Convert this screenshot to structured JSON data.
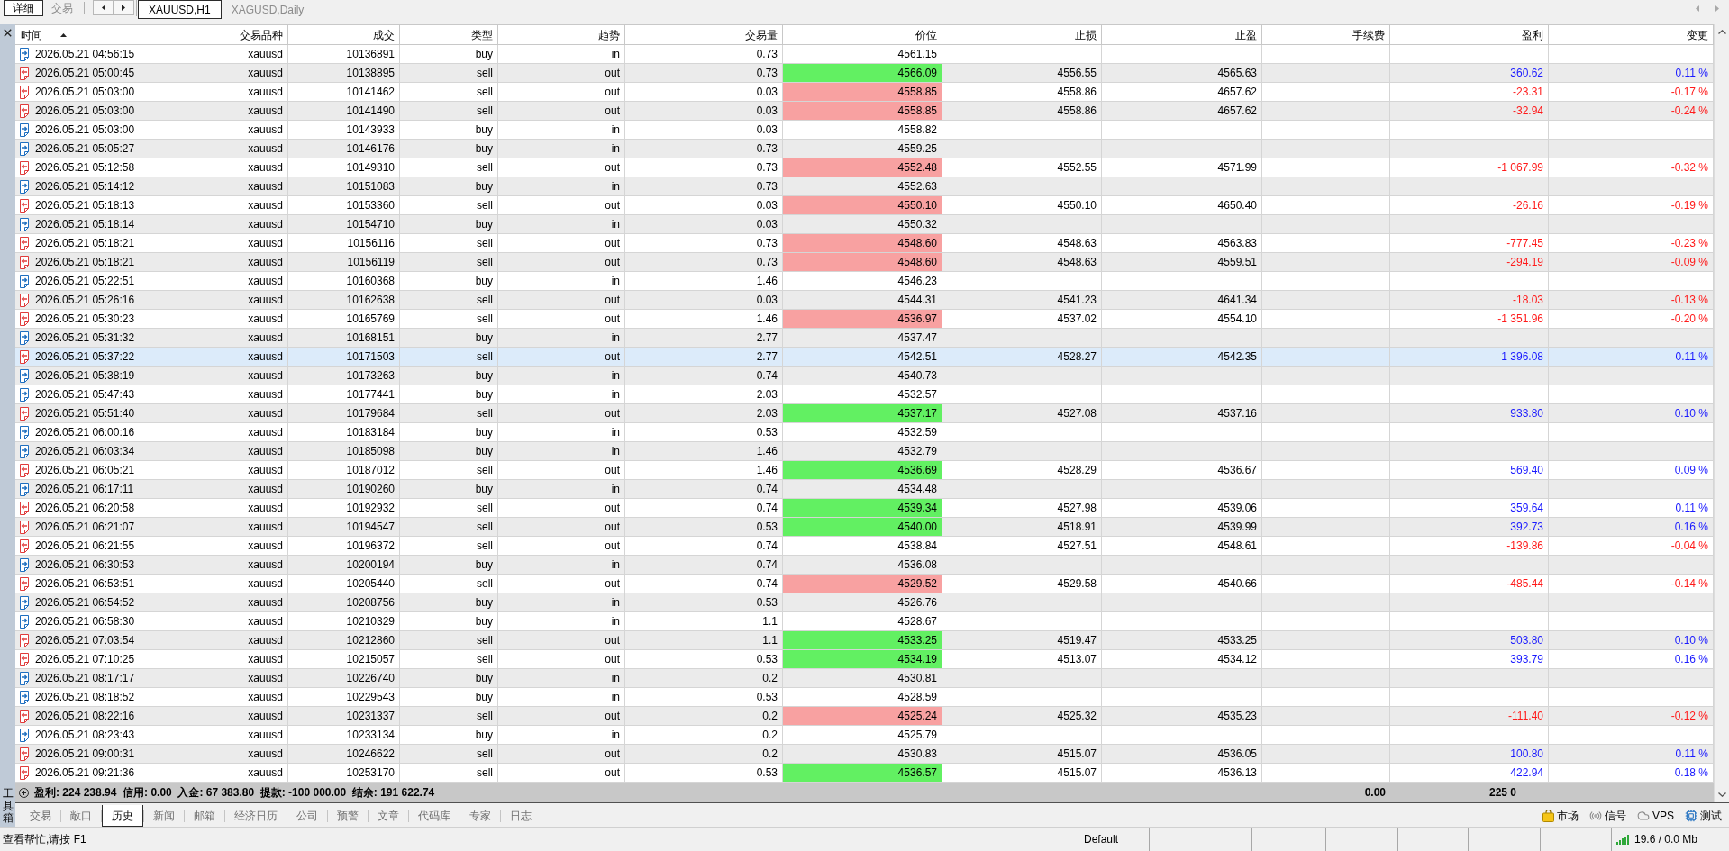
{
  "view_tabs": [
    {
      "label": "详细",
      "selected": true
    },
    {
      "label": "交易",
      "selected": false
    }
  ],
  "chart_tabs": [
    {
      "label": "XAUUSD,H1",
      "selected": true
    },
    {
      "label": "XAGUSD,Daily",
      "selected": false
    }
  ],
  "toolbox": {
    "title": "工具箱"
  },
  "table": {
    "columns": [
      {
        "label": "时间",
        "sorted": true
      },
      {
        "label": "交易品种",
        "sorted": false
      },
      {
        "label": "成交",
        "sorted": false
      },
      {
        "label": "类型",
        "sorted": false
      },
      {
        "label": "趋势",
        "sorted": false
      },
      {
        "label": "交易量",
        "sorted": false
      },
      {
        "label": "价位",
        "sorted": false
      },
      {
        "label": "止损",
        "sorted": false
      },
      {
        "label": "止盈",
        "sorted": false
      },
      {
        "label": "手续费",
        "sorted": false
      },
      {
        "label": "盈利",
        "sorted": false
      },
      {
        "label": "变更",
        "sorted": false
      }
    ],
    "rows": [
      {
        "kind": "buy",
        "selected": false,
        "time": "2026.05.21 04:56:15",
        "symbol": "xauusd",
        "deal": "10136891",
        "type": "buy",
        "direction": "in",
        "volume": "0.73",
        "price": {
          "value": "4561.15"
        }
      },
      {
        "kind": "sell",
        "selected": false,
        "time": "2026.05.21 05:00:45",
        "symbol": "xauusd",
        "deal": "10138895",
        "type": "sell",
        "direction": "out",
        "volume": "0.73",
        "price": {
          "value": "4566.09",
          "color": "#62f062"
        },
        "stop_loss": "4556.55",
        "take_profit": "4565.63",
        "profit": {
          "value": "360.62",
          "color": "#1a1aff"
        },
        "change": {
          "value": "0.11 %",
          "color": "#1a1aff"
        }
      },
      {
        "kind": "sell",
        "selected": false,
        "time": "2026.05.21 05:03:00",
        "symbol": "xauusd",
        "deal": "10141462",
        "type": "sell",
        "direction": "out",
        "volume": "0.03",
        "price": {
          "value": "4558.85",
          "color": "#f8a1a1"
        },
        "stop_loss": "4558.86",
        "take_profit": "4657.62",
        "profit": {
          "value": "-23.31",
          "color": "#ff1a1a"
        },
        "change": {
          "value": "-0.17 %",
          "color": "#ff1a1a"
        }
      },
      {
        "kind": "sell",
        "selected": false,
        "time": "2026.05.21 05:03:00",
        "symbol": "xauusd",
        "deal": "10141490",
        "type": "sell",
        "direction": "out",
        "volume": "0.03",
        "price": {
          "value": "4558.85",
          "color": "#f8a1a1"
        },
        "stop_loss": "4558.86",
        "take_profit": "4657.62",
        "profit": {
          "value": "-32.94",
          "color": "#ff1a1a"
        },
        "change": {
          "value": "-0.24 %",
          "color": "#ff1a1a"
        }
      },
      {
        "kind": "buy",
        "selected": false,
        "time": "2026.05.21 05:03:00",
        "symbol": "xauusd",
        "deal": "10143933",
        "type": "buy",
        "direction": "in",
        "volume": "0.03",
        "price": {
          "value": "4558.82"
        }
      },
      {
        "kind": "buy",
        "selected": false,
        "time": "2026.05.21 05:05:27",
        "symbol": "xauusd",
        "deal": "10146176",
        "type": "buy",
        "direction": "in",
        "volume": "0.73",
        "price": {
          "value": "4559.25"
        }
      },
      {
        "kind": "sell",
        "selected": false,
        "time": "2026.05.21 05:12:58",
        "symbol": "xauusd",
        "deal": "10149310",
        "type": "sell",
        "direction": "out",
        "volume": "0.73",
        "price": {
          "value": "4552.48",
          "color": "#f8a1a1"
        },
        "stop_loss": "4552.55",
        "take_profit": "4571.99",
        "profit": {
          "value": "-1 067.99",
          "color": "#ff1a1a"
        },
        "change": {
          "value": "-0.32 %",
          "color": "#ff1a1a"
        }
      },
      {
        "kind": "buy",
        "selected": false,
        "time": "2026.05.21 05:14:12",
        "symbol": "xauusd",
        "deal": "10151083",
        "type": "buy",
        "direction": "in",
        "volume": "0.73",
        "price": {
          "value": "4552.63"
        }
      },
      {
        "kind": "sell",
        "selected": false,
        "time": "2026.05.21 05:18:13",
        "symbol": "xauusd",
        "deal": "10153360",
        "type": "sell",
        "direction": "out",
        "volume": "0.03",
        "price": {
          "value": "4550.10",
          "color": "#f8a1a1"
        },
        "stop_loss": "4550.10",
        "take_profit": "4650.40",
        "profit": {
          "value": "-26.16",
          "color": "#ff1a1a"
        },
        "change": {
          "value": "-0.19 %",
          "color": "#ff1a1a"
        }
      },
      {
        "kind": "buy",
        "selected": false,
        "time": "2026.05.21 05:18:14",
        "symbol": "xauusd",
        "deal": "10154710",
        "type": "buy",
        "direction": "in",
        "volume": "0.03",
        "price": {
          "value": "4550.32"
        }
      },
      {
        "kind": "sell",
        "selected": false,
        "time": "2026.05.21 05:18:21",
        "symbol": "xauusd",
        "deal": "10156116",
        "type": "sell",
        "direction": "out",
        "volume": "0.73",
        "price": {
          "value": "4548.60",
          "color": "#f8a1a1"
        },
        "stop_loss": "4548.63",
        "take_profit": "4563.83",
        "profit": {
          "value": "-777.45",
          "color": "#ff1a1a"
        },
        "change": {
          "value": "-0.23 %",
          "color": "#ff1a1a"
        }
      },
      {
        "kind": "sell",
        "selected": false,
        "time": "2026.05.21 05:18:21",
        "symbol": "xauusd",
        "deal": "10156119",
        "type": "sell",
        "direction": "out",
        "volume": "0.73",
        "price": {
          "value": "4548.60",
          "color": "#f8a1a1"
        },
        "stop_loss": "4548.63",
        "take_profit": "4559.51",
        "profit": {
          "value": "-294.19",
          "color": "#ff1a1a"
        },
        "change": {
          "value": "-0.09 %",
          "color": "#ff1a1a"
        }
      },
      {
        "kind": "buy",
        "selected": false,
        "time": "2026.05.21 05:22:51",
        "symbol": "xauusd",
        "deal": "10160368",
        "type": "buy",
        "direction": "in",
        "volume": "1.46",
        "price": {
          "value": "4546.23"
        }
      },
      {
        "kind": "sell",
        "selected": false,
        "time": "2026.05.21 05:26:16",
        "symbol": "xauusd",
        "deal": "10162638",
        "type": "sell",
        "direction": "out",
        "volume": "0.03",
        "price": {
          "value": "4544.31"
        },
        "stop_loss": "4541.23",
        "take_profit": "4641.34",
        "profit": {
          "value": "-18.03",
          "color": "#ff1a1a"
        },
        "change": {
          "value": "-0.13 %",
          "color": "#ff1a1a"
        }
      },
      {
        "kind": "sell",
        "selected": false,
        "time": "2026.05.21 05:30:23",
        "symbol": "xauusd",
        "deal": "10165769",
        "type": "sell",
        "direction": "out",
        "volume": "1.46",
        "price": {
          "value": "4536.97",
          "color": "#f8a1a1"
        },
        "stop_loss": "4537.02",
        "take_profit": "4554.10",
        "profit": {
          "value": "-1 351.96",
          "color": "#ff1a1a"
        },
        "change": {
          "value": "-0.20 %",
          "color": "#ff1a1a"
        }
      },
      {
        "kind": "buy",
        "selected": false,
        "time": "2026.05.21 05:31:32",
        "symbol": "xauusd",
        "deal": "10168151",
        "type": "buy",
        "direction": "in",
        "volume": "2.77",
        "price": {
          "value": "4537.47"
        }
      },
      {
        "kind": "sell",
        "selected": true,
        "time": "2026.05.21 05:37:22",
        "symbol": "xauusd",
        "deal": "10171503",
        "type": "sell",
        "direction": "out",
        "volume": "2.77",
        "price": {
          "value": "4542.51"
        },
        "stop_loss": "4528.27",
        "take_profit": "4542.35",
        "profit": {
          "value": "1 396.08",
          "color": "#1a1aff"
        },
        "change": {
          "value": "0.11 %",
          "color": "#1a1aff"
        }
      },
      {
        "kind": "buy",
        "selected": false,
        "time": "2026.05.21 05:38:19",
        "symbol": "xauusd",
        "deal": "10173263",
        "type": "buy",
        "direction": "in",
        "volume": "0.74",
        "price": {
          "value": "4540.73"
        }
      },
      {
        "kind": "buy",
        "selected": false,
        "time": "2026.05.21 05:47:43",
        "symbol": "xauusd",
        "deal": "10177441",
        "type": "buy",
        "direction": "in",
        "volume": "2.03",
        "price": {
          "value": "4532.57"
        }
      },
      {
        "kind": "sell",
        "selected": false,
        "time": "2026.05.21 05:51:40",
        "symbol": "xauusd",
        "deal": "10179684",
        "type": "sell",
        "direction": "out",
        "volume": "2.03",
        "price": {
          "value": "4537.17",
          "color": "#62f062"
        },
        "stop_loss": "4527.08",
        "take_profit": "4537.16",
        "profit": {
          "value": "933.80",
          "color": "#1a1aff"
        },
        "change": {
          "value": "0.10 %",
          "color": "#1a1aff"
        }
      },
      {
        "kind": "buy",
        "selected": false,
        "time": "2026.05.21 06:00:16",
        "symbol": "xauusd",
        "deal": "10183184",
        "type": "buy",
        "direction": "in",
        "volume": "0.53",
        "price": {
          "value": "4532.59"
        }
      },
      {
        "kind": "buy",
        "selected": false,
        "time": "2026.05.21 06:03:34",
        "symbol": "xauusd",
        "deal": "10185098",
        "type": "buy",
        "direction": "in",
        "volume": "1.46",
        "price": {
          "value": "4532.79"
        }
      },
      {
        "kind": "sell",
        "selected": false,
        "time": "2026.05.21 06:05:21",
        "symbol": "xauusd",
        "deal": "10187012",
        "type": "sell",
        "direction": "out",
        "volume": "1.46",
        "price": {
          "value": "4536.69",
          "color": "#62f062"
        },
        "stop_loss": "4528.29",
        "take_profit": "4536.67",
        "profit": {
          "value": "569.40",
          "color": "#1a1aff"
        },
        "change": {
          "value": "0.09 %",
          "color": "#1a1aff"
        }
      },
      {
        "kind": "buy",
        "selected": false,
        "time": "2026.05.21 06:17:11",
        "symbol": "xauusd",
        "deal": "10190260",
        "type": "buy",
        "direction": "in",
        "volume": "0.74",
        "price": {
          "value": "4534.48"
        }
      },
      {
        "kind": "sell",
        "selected": false,
        "time": "2026.05.21 06:20:58",
        "symbol": "xauusd",
        "deal": "10192932",
        "type": "sell",
        "direction": "out",
        "volume": "0.74",
        "price": {
          "value": "4539.34",
          "color": "#62f062"
        },
        "stop_loss": "4527.98",
        "take_profit": "4539.06",
        "profit": {
          "value": "359.64",
          "color": "#1a1aff"
        },
        "change": {
          "value": "0.11 %",
          "color": "#1a1aff"
        }
      },
      {
        "kind": "sell",
        "selected": false,
        "time": "2026.05.21 06:21:07",
        "symbol": "xauusd",
        "deal": "10194547",
        "type": "sell",
        "direction": "out",
        "volume": "0.53",
        "price": {
          "value": "4540.00",
          "color": "#62f062"
        },
        "stop_loss": "4518.91",
        "take_profit": "4539.99",
        "profit": {
          "value": "392.73",
          "color": "#1a1aff"
        },
        "change": {
          "value": "0.16 %",
          "color": "#1a1aff"
        }
      },
      {
        "kind": "sell",
        "selected": false,
        "time": "2026.05.21 06:21:55",
        "symbol": "xauusd",
        "deal": "10196372",
        "type": "sell",
        "direction": "out",
        "volume": "0.74",
        "price": {
          "value": "4538.84"
        },
        "stop_loss": "4527.51",
        "take_profit": "4548.61",
        "profit": {
          "value": "-139.86",
          "color": "#ff1a1a"
        },
        "change": {
          "value": "-0.04 %",
          "color": "#ff1a1a"
        }
      },
      {
        "kind": "buy",
        "selected": false,
        "time": "2026.05.21 06:30:53",
        "symbol": "xauusd",
        "deal": "10200194",
        "type": "buy",
        "direction": "in",
        "volume": "0.74",
        "price": {
          "value": "4536.08"
        }
      },
      {
        "kind": "sell",
        "selected": false,
        "time": "2026.05.21 06:53:51",
        "symbol": "xauusd",
        "deal": "10205440",
        "type": "sell",
        "direction": "out",
        "volume": "0.74",
        "price": {
          "value": "4529.52",
          "color": "#f8a1a1"
        },
        "stop_loss": "4529.58",
        "take_profit": "4540.66",
        "profit": {
          "value": "-485.44",
          "color": "#ff1a1a"
        },
        "change": {
          "value": "-0.14 %",
          "color": "#ff1a1a"
        }
      },
      {
        "kind": "buy",
        "selected": false,
        "time": "2026.05.21 06:54:52",
        "symbol": "xauusd",
        "deal": "10208756",
        "type": "buy",
        "direction": "in",
        "volume": "0.53",
        "price": {
          "value": "4526.76"
        }
      },
      {
        "kind": "buy",
        "selected": false,
        "time": "2026.05.21 06:58:30",
        "symbol": "xauusd",
        "deal": "10210329",
        "type": "buy",
        "direction": "in",
        "volume": "1.1",
        "price": {
          "value": "4528.67"
        }
      },
      {
        "kind": "sell",
        "selected": false,
        "time": "2026.05.21 07:03:54",
        "symbol": "xauusd",
        "deal": "10212860",
        "type": "sell",
        "direction": "out",
        "volume": "1.1",
        "price": {
          "value": "4533.25",
          "color": "#62f062"
        },
        "stop_loss": "4519.47",
        "take_profit": "4533.25",
        "profit": {
          "value": "503.80",
          "color": "#1a1aff"
        },
        "change": {
          "value": "0.10 %",
          "color": "#1a1aff"
        }
      },
      {
        "kind": "sell",
        "selected": false,
        "time": "2026.05.21 07:10:25",
        "symbol": "xauusd",
        "deal": "10215057",
        "type": "sell",
        "direction": "out",
        "volume": "0.53",
        "price": {
          "value": "4534.19",
          "color": "#62f062"
        },
        "stop_loss": "4513.07",
        "take_profit": "4534.12",
        "profit": {
          "value": "393.79",
          "color": "#1a1aff"
        },
        "change": {
          "value": "0.16 %",
          "color": "#1a1aff"
        }
      },
      {
        "kind": "buy",
        "selected": false,
        "time": "2026.05.21 08:17:17",
        "symbol": "xauusd",
        "deal": "10226740",
        "type": "buy",
        "direction": "in",
        "volume": "0.2",
        "price": {
          "value": "4530.81"
        }
      },
      {
        "kind": "buy",
        "selected": false,
        "time": "2026.05.21 08:18:52",
        "symbol": "xauusd",
        "deal": "10229543",
        "type": "buy",
        "direction": "in",
        "volume": "0.53",
        "price": {
          "value": "4528.59"
        }
      },
      {
        "kind": "sell",
        "selected": false,
        "time": "2026.05.21 08:22:16",
        "symbol": "xauusd",
        "deal": "10231337",
        "type": "sell",
        "direction": "out",
        "volume": "0.2",
        "price": {
          "value": "4525.24",
          "color": "#f8a1a1"
        },
        "stop_loss": "4525.32",
        "take_profit": "4535.23",
        "profit": {
          "value": "-111.40",
          "color": "#ff1a1a"
        },
        "change": {
          "value": "-0.12 %",
          "color": "#ff1a1a"
        }
      },
      {
        "kind": "buy",
        "selected": false,
        "time": "2026.05.21 08:23:43",
        "symbol": "xauusd",
        "deal": "10233134",
        "type": "buy",
        "direction": "in",
        "volume": "0.2",
        "price": {
          "value": "4525.79"
        }
      },
      {
        "kind": "sell",
        "selected": false,
        "time": "2026.05.21 09:00:31",
        "symbol": "xauusd",
        "deal": "10246622",
        "type": "sell",
        "direction": "out",
        "volume": "0.2",
        "price": {
          "value": "4530.83"
        },
        "stop_loss": "4515.07",
        "take_profit": "4536.05",
        "profit": {
          "value": "100.80",
          "color": "#1a1aff"
        },
        "change": {
          "value": "0.11 %",
          "color": "#1a1aff"
        }
      },
      {
        "kind": "sell",
        "selected": false,
        "time": "2026.05.21 09:21:36",
        "symbol": "xauusd",
        "deal": "10253170",
        "type": "sell",
        "direction": "out",
        "volume": "0.53",
        "price": {
          "value": "4536.57",
          "color": "#62f062"
        },
        "stop_loss": "4515.07",
        "take_profit": "4536.13",
        "profit": {
          "value": "422.94",
          "color": "#1a1aff"
        },
        "change": {
          "value": "0.18 %",
          "color": "#1a1aff"
        }
      }
    ]
  },
  "summary": {
    "text": "盈利: 224 238.94  信用: 0.00  入金: 67 383.80  提款: -100 000.00  结余: 191 622.74",
    "fee_total": "0.00",
    "profit_total": "225 0"
  },
  "panel_tabs": [
    {
      "label": "交易",
      "selected": false
    },
    {
      "label": "敞口",
      "selected": false
    },
    {
      "label": "历史",
      "selected": true
    },
    {
      "label": "新闻",
      "selected": false
    },
    {
      "label": "邮箱",
      "selected": false
    },
    {
      "label": "经济日历",
      "selected": false
    },
    {
      "label": "公司",
      "selected": false
    },
    {
      "label": "预警",
      "selected": false
    },
    {
      "label": "文章",
      "selected": false
    },
    {
      "label": "代码库",
      "selected": false
    },
    {
      "label": "专家",
      "selected": false
    },
    {
      "label": "日志",
      "selected": false
    }
  ],
  "toolbar": [
    {
      "kind": "market",
      "label": "市场"
    },
    {
      "kind": "signals",
      "label": "信号"
    },
    {
      "kind": "vps",
      "label": "VPS"
    },
    {
      "kind": "tester",
      "label": "测试"
    }
  ],
  "status_bar": {
    "help": "查看帮忙,请按 F1",
    "profile": "Default",
    "traffic": "19.6 / 0.0 Mb"
  }
}
